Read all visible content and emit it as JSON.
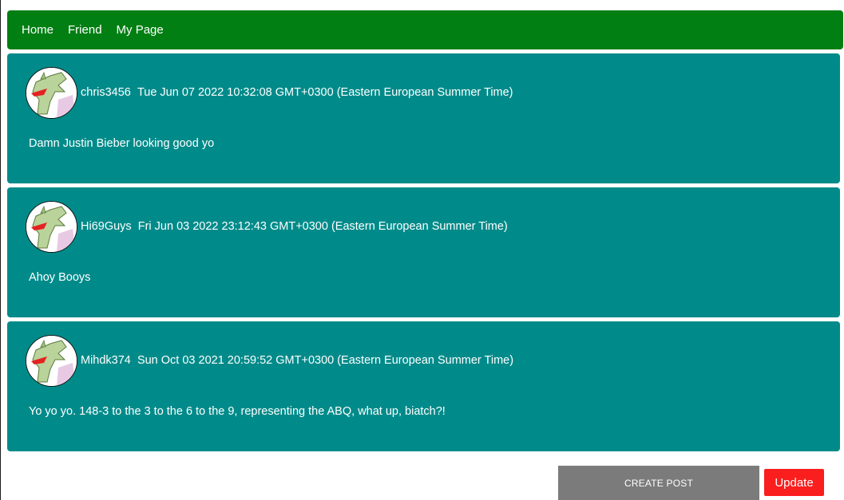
{
  "nav": {
    "items": [
      "Home",
      "Friend",
      "My Page"
    ]
  },
  "posts": [
    {
      "author": "chris3456",
      "timestamp": "Tue Jun 07 2022 10:32:08 GMT+0300 (Eastern European Summer Time)",
      "body": "Damn Justin Bieber looking good yo"
    },
    {
      "author": "Hi69Guys",
      "timestamp": "Fri Jun 03 2022 23:12:43 GMT+0300 (Eastern European Summer Time)",
      "body": "Ahoy Booys"
    },
    {
      "author": "Mihdk374",
      "timestamp": "Sun Oct 03 2021 20:59:52 GMT+0300 (Eastern European Summer Time)",
      "body": "Yo yo yo. 148-3 to the 3 to the 6 to the 9, representing the ABQ, what up, biatch?!"
    }
  ],
  "actions": {
    "create_post_label": "CREATE POST",
    "update_label": "Update"
  },
  "colors": {
    "navbar": "#027f13",
    "post_card": "#008b8a",
    "create_button": "#7b7b7b",
    "update_button": "#fb1e1e"
  },
  "icons": {
    "avatar": "dinosaur-avatar-icon"
  }
}
